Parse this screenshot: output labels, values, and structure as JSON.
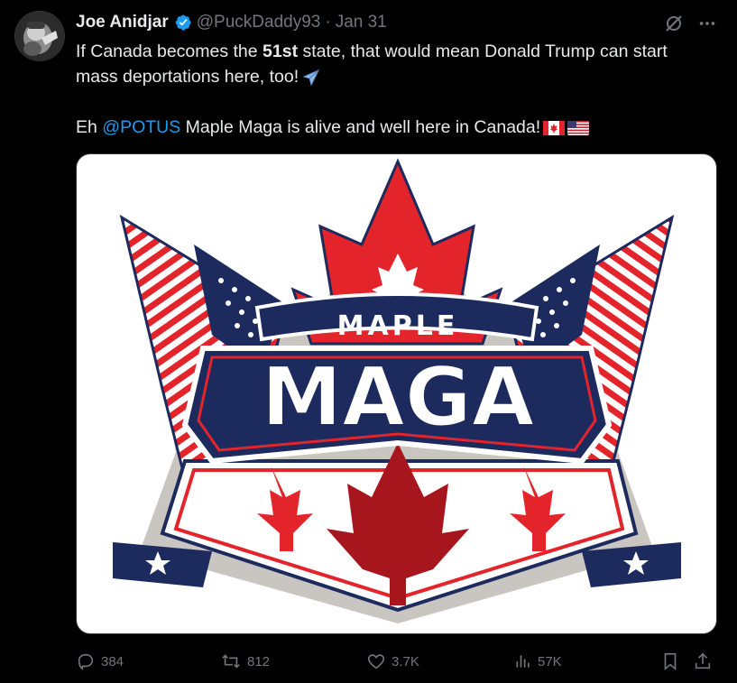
{
  "tweet": {
    "author_name": "Joe Anidjar",
    "handle": "@PuckDaddy93",
    "separator": "·",
    "date": "Jan 31",
    "line1_a": "If Canada becomes the ",
    "line1_bold": "51st",
    "line1_b": " state, that would mean Donald Trump can start mass deportations here, too!",
    "line2_a": "Eh ",
    "mention": "@POTUS",
    "line2_b": " Maple Maga is alive and well here in Canada!"
  },
  "image": {
    "small_word": "MAPLE",
    "big_word": "MAGA",
    "colors": {
      "red": "#e3242b",
      "navy": "#1c2a5e",
      "white": "#ffffff"
    }
  },
  "actions": {
    "replies": "384",
    "reposts": "812",
    "likes": "3.7K",
    "views": "57K"
  },
  "icons": [
    "verified-badge-icon",
    "grok-icon",
    "more-icon",
    "airplane-icon",
    "canada-flag-icon",
    "us-flag-icon",
    "reply-icon",
    "repost-icon",
    "like-icon",
    "views-icon",
    "bookmark-icon",
    "share-icon"
  ]
}
